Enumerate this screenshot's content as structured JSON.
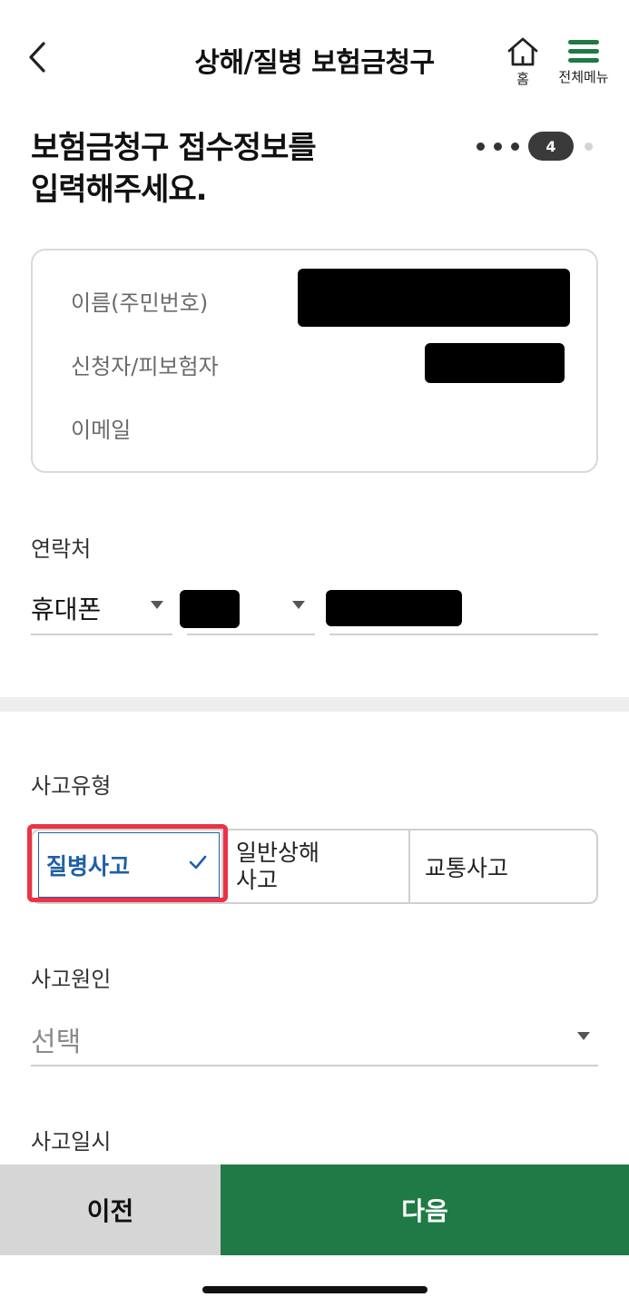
{
  "header": {
    "title": "상해/질병 보험금청구",
    "home_label": "홈",
    "menu_label": "전체메뉴",
    "back_icon": "chevron-left-icon",
    "home_icon": "home-icon",
    "menu_icon": "hamburger-menu-icon"
  },
  "page": {
    "heading": "보험금청구 접수정보를\n입력해주세요.",
    "step": {
      "current": "4"
    }
  },
  "info_card": {
    "name_label": "이름(주민번호)",
    "relation_label": "신청자/피보험자",
    "email_label": "이메일"
  },
  "contact": {
    "label": "연락처",
    "phone_type": "휴대폰"
  },
  "accident_type": {
    "label": "사고유형",
    "options": [
      "질병사고",
      "일반상해\n사고",
      "교통사고"
    ],
    "selected": "질병사고"
  },
  "accident_cause": {
    "label": "사고원인",
    "placeholder": "선택"
  },
  "accident_date": {
    "label": "사고일시"
  },
  "footer": {
    "prev_label": "이전",
    "next_label": "다음"
  },
  "colors": {
    "brand_green": "#1f7a45",
    "selected_blue": "#1f5fa6",
    "highlight_red": "#ea3347"
  }
}
